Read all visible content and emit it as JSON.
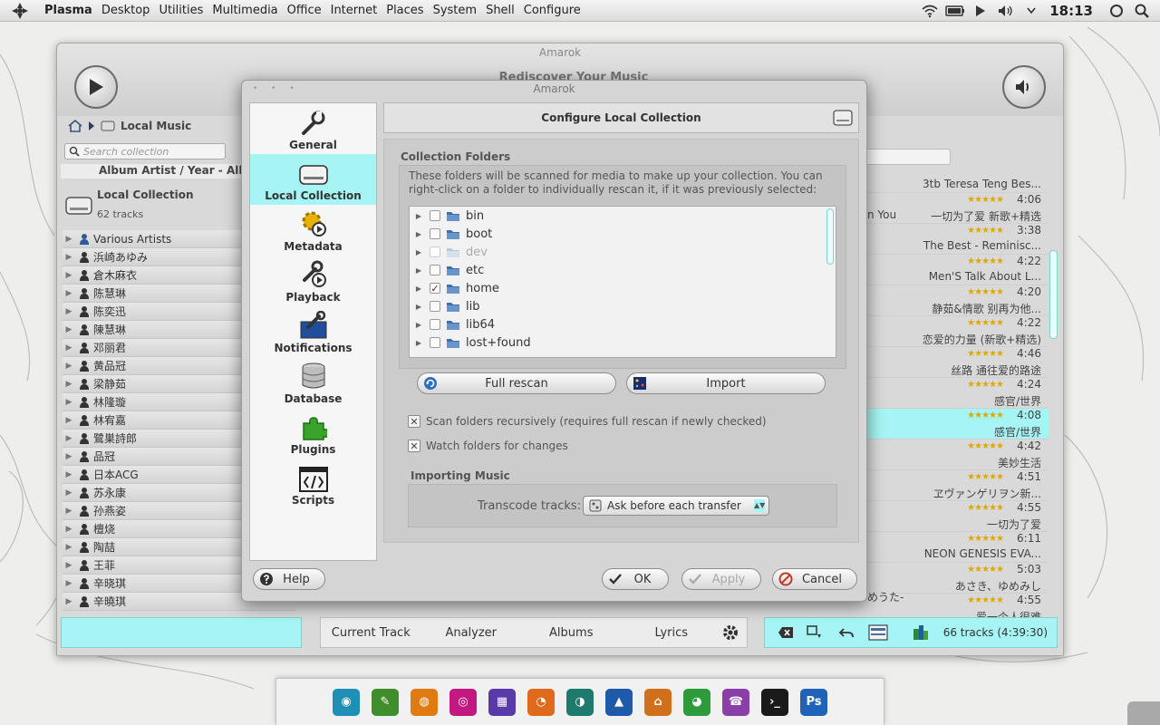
{
  "top_panel": {
    "menu": [
      "Plasma",
      "Desktop",
      "Utilities",
      "Multimedia",
      "Office",
      "Internet",
      "Places",
      "System",
      "Shell",
      "Configure"
    ],
    "clock": "18:13",
    "tray_icons": [
      "wifi-icon",
      "battery-icon",
      "play-icon",
      "volume-icon",
      "chevron-down-icon"
    ]
  },
  "amarok": {
    "title": "Amarok",
    "rediscover": "Rediscover Your Music",
    "breadcrumb": "Local Music",
    "search_placeholder": "Search collection",
    "sort_label": "Album Artist / Year - Album",
    "collection_title": "Local Collection",
    "collection_count": "62 tracks",
    "artists": [
      "Various Artists",
      "浜崎あゆみ",
      "倉木麻衣",
      "陈慧琳",
      "陈奕迅",
      "陳慧琳",
      "邓丽君",
      "黄品冠",
      "梁静茹",
      "林隆璇",
      "林宥嘉",
      "鷺巣詩郎",
      "品冠",
      "日本ACG",
      "苏永康",
      "孙燕姿",
      "檀烧",
      "陶喆",
      "王菲",
      "辛晓琪",
      "辛曉琪"
    ],
    "bottom_tabs": [
      "Current Track",
      "Analyzer",
      "Albums",
      "Lyrics"
    ],
    "tracks": [
      {
        "len": "",
        "album": "3tb Teresa Teng Bes..."
      },
      {
        "len": "4:06",
        "album": "一切为了爱 新歌+精选"
      },
      {
        "len": "3:38",
        "album": "The Best - Reminisc..."
      },
      {
        "len": "4:22",
        "album": "Men'S Talk About L..."
      },
      {
        "len": "4:20",
        "album": "静茹&情歌 别再为他..."
      },
      {
        "len": "4:22",
        "album": "恋爱的力量 (新歌+精选)"
      },
      {
        "len": "4:46",
        "album": "丝路 通往爱的路途"
      },
      {
        "len": "4:24",
        "album": "感官/世界"
      },
      {
        "len": "4:08",
        "album": "感官/世界"
      },
      {
        "len": "4:42",
        "album": "美妙生活"
      },
      {
        "len": "4:51",
        "album": "ヱヴァンゲリヲン新..."
      },
      {
        "len": "4:55",
        "album": "一切为了爱"
      },
      {
        "len": "6:11",
        "album": "NEON GENESIS EVA..."
      },
      {
        "len": "5:03",
        "album": "あさき、ゆめみし"
      },
      {
        "len": "4:55",
        "album": "爱一个人很难"
      }
    ],
    "track_partial": [
      "n You",
      "めうた-"
    ],
    "playlist_count": "66 tracks (4:39:30)"
  },
  "dialog": {
    "title": "Amarok",
    "header": "Configure Local Collection",
    "sidebar": [
      {
        "label": "General",
        "icon": "wrench-icon"
      },
      {
        "label": "Local Collection",
        "icon": "hard-drive-icon"
      },
      {
        "label": "Metadata",
        "icon": "puzzle-gear-icon"
      },
      {
        "label": "Playback",
        "icon": "playback-icon"
      },
      {
        "label": "Notifications",
        "icon": "notifications-icon"
      },
      {
        "label": "Database",
        "icon": "database-icon"
      },
      {
        "label": "Plugins",
        "icon": "puzzle-icon"
      },
      {
        "label": "Scripts",
        "icon": "script-icon"
      }
    ],
    "folders_group": "Collection Folders",
    "folders_desc": "These folders will be scanned for media to make up your collection. You can right-click on a folder to individually rescan it, if it was previously selected:",
    "folders": [
      {
        "name": "bin",
        "checked": false,
        "dim": false
      },
      {
        "name": "boot",
        "checked": false,
        "dim": false
      },
      {
        "name": "dev",
        "checked": false,
        "dim": true
      },
      {
        "name": "etc",
        "checked": false,
        "dim": false
      },
      {
        "name": "home",
        "checked": true,
        "dim": false
      },
      {
        "name": "lib",
        "checked": false,
        "dim": false
      },
      {
        "name": "lib64",
        "checked": false,
        "dim": false
      },
      {
        "name": "lost+found",
        "checked": false,
        "dim": false
      }
    ],
    "full_rescan": "Full rescan",
    "import": "Import",
    "scan_recursive": "Scan folders recursively (requires full rescan if newly checked)",
    "watch_folders": "Watch folders for changes",
    "importing_group": "Importing Music",
    "transcode_label": "Transcode tracks:",
    "transcode_value": "Ask before each transfer",
    "help": "Help",
    "ok": "OK",
    "apply": "Apply",
    "cancel": "Cancel"
  },
  "colors": {
    "accent": "#a6f4f4",
    "star": "#e0a800"
  }
}
